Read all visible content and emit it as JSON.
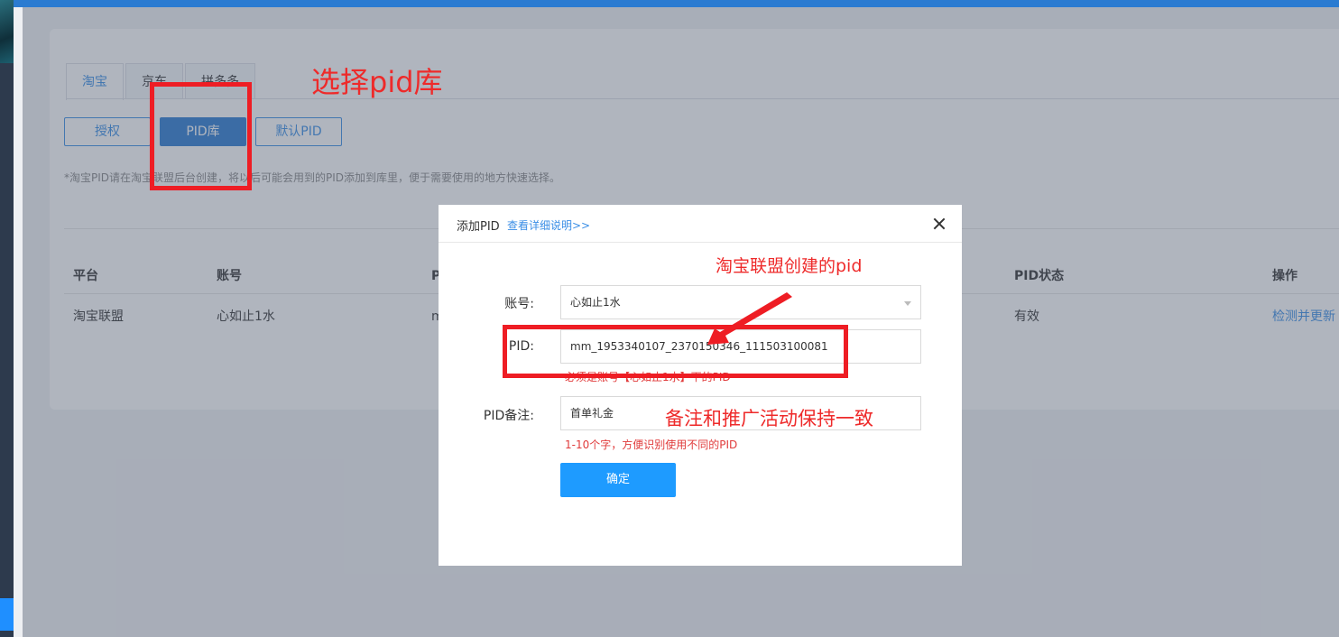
{
  "tabs": [
    "淘宝",
    "京东",
    "拼多多"
  ],
  "buttons": {
    "auth": "授权",
    "pid_lib": "PID库",
    "default_pid": "默认PID"
  },
  "hint": "*淘宝PID请在淘宝联盟后台创建，将以后可能会用到的PID添加到库里，便于需要使用的地方快速选择。",
  "table": {
    "headers": {
      "platform": "平台",
      "account": "账号",
      "pid": "PI",
      "status": "PID状态",
      "action": "操作"
    },
    "row": {
      "platform": "淘宝联盟",
      "account": "心如止1水",
      "pid": "m",
      "status": "有效",
      "action": "检测并更新"
    }
  },
  "modal": {
    "title": "添加PID",
    "detail_link": "查看详细说明>>",
    "account_label": "账号:",
    "account_value": "心如止1水",
    "pid_label": "PID:",
    "pid_value": "mm_1953340107_2370150346_111503100081",
    "pid_help": "必须是账号【心如止1水】下的PID",
    "note_label": "PID备注:",
    "note_value": "首单礼金",
    "note_help": "1-10个字，方便识别使用不同的PID",
    "confirm": "确定"
  },
  "annotations": {
    "select_lib": "选择pid库",
    "created_pid": "淘宝联盟创建的pid",
    "note_consistent": "备注和推广活动保持一致"
  },
  "colors": {
    "accent": "#3a8ee6",
    "primary": "#2a7bd1",
    "annotation": "#ee1d24"
  }
}
